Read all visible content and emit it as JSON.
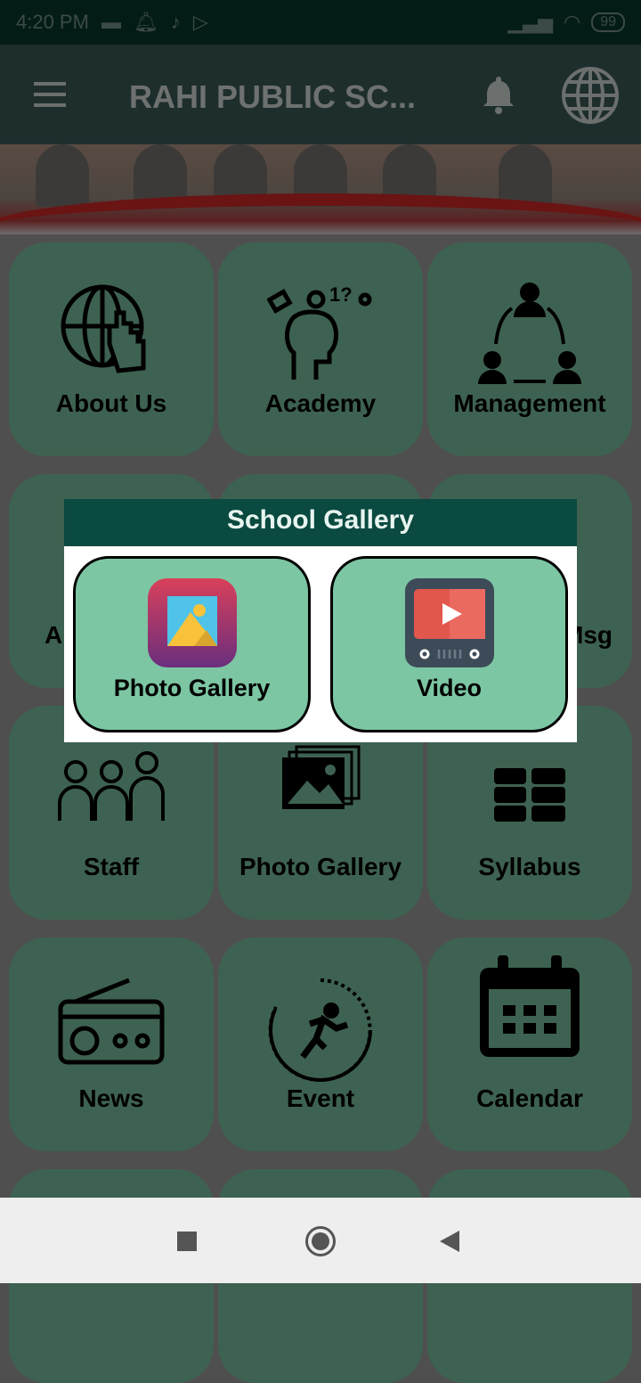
{
  "status_bar": {
    "time": "4:20 PM",
    "battery": "99",
    "icons": [
      "message-icon",
      "notification-icon",
      "tiktok-icon",
      "play-store-icon",
      "signal-icon",
      "wifi-icon",
      "battery-icon"
    ]
  },
  "app_bar": {
    "title": "RAHI PUBLIC SC...",
    "icons": [
      "menu-icon",
      "bell-icon",
      "globe-icon"
    ]
  },
  "grid": {
    "items": [
      {
        "label": "About Us",
        "icon": "globe-hand-icon"
      },
      {
        "label": "Academy",
        "icon": "head-thinking-icon"
      },
      {
        "label": "Management",
        "icon": "people-network-icon"
      },
      {
        "label": "A",
        "icon": "person-icon"
      },
      {
        "label": "",
        "icon": ""
      },
      {
        "label": "Msg",
        "icon": ""
      },
      {
        "label": "Staff",
        "icon": "staff-icon"
      },
      {
        "label": "Photo Gallery",
        "icon": "photos-icon"
      },
      {
        "label": "Syllabus",
        "icon": "books-icon"
      },
      {
        "label": "News",
        "icon": "radio-icon"
      },
      {
        "label": "Event",
        "icon": "runner-icon"
      },
      {
        "label": "Calendar",
        "icon": "calendar-icon"
      }
    ]
  },
  "dialog": {
    "title": "School Gallery",
    "buttons": [
      {
        "label": "Photo Gallery",
        "icon": "gallery-icon"
      },
      {
        "label": "Video",
        "icon": "video-player-icon"
      }
    ]
  },
  "colors": {
    "dialog_header": "#0a4a40",
    "tile": "#7cc6a3",
    "tile_dimmed": "#3e6251"
  }
}
